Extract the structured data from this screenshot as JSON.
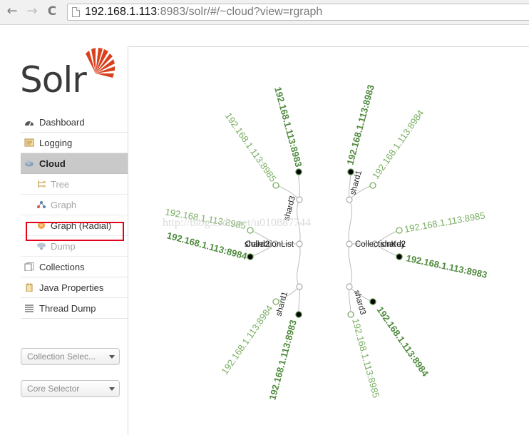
{
  "browser": {
    "back_icon": "←",
    "forward_icon": "→",
    "reload_icon": "C",
    "url_host": "192.168.1.113",
    "url_rest": ":8983/solr/#/~cloud?view=rgraph"
  },
  "logo": {
    "text": "Solr"
  },
  "sidebar": {
    "items": [
      {
        "label": "Dashboard",
        "icon": "dashboard-icon"
      },
      {
        "label": "Logging",
        "icon": "logging-icon"
      },
      {
        "label": "Cloud",
        "icon": "cloud-icon",
        "active": true
      },
      {
        "label": "Tree",
        "icon": "tree-icon"
      },
      {
        "label": "Graph",
        "icon": "graph-icon"
      },
      {
        "label": "Graph (Radial)",
        "icon": "radial-graph-icon",
        "selected": true
      },
      {
        "label": "Dump",
        "icon": "dump-icon"
      },
      {
        "label": "Collections",
        "icon": "collections-icon"
      },
      {
        "label": "Java Properties",
        "icon": "java-properties-icon"
      },
      {
        "label": "Thread Dump",
        "icon": "thread-dump-icon"
      }
    ],
    "collection_selector": "Collection Selec...",
    "core_selector": "Core Selector"
  },
  "graph": {
    "left_collection": "CollectionList",
    "left_collection_overlap": "shard2",
    "right_collection": "CollectionKey",
    "right_collection_overlap": "shard2",
    "shards": {
      "top_left": "shard3",
      "bottom_left": "shard1",
      "top_right": "shard1",
      "bottom_right": "shard3"
    },
    "replicas": {
      "tl_leader": "192.168.1.113:8983",
      "tl_follower": "192.168.1.113:8985",
      "ml_follower": "192.168.1.113:8985",
      "ml_leader": "192.168.1.113:8984",
      "bl_follower": "192.168.1.113:8984",
      "bl_leader": "192.168.1.113:8983",
      "tr_leader": "192.168.1.113:8983",
      "tr_follower": "192.168.1.113:8984",
      "mr_follower": "192.168.1.113:8985",
      "mr_leader": "192.168.1.113:8983",
      "br_leader": "192.168.1.113:8984",
      "br_follower": "192.168.1.113:8985"
    },
    "colors": {
      "leader": "#4f8a3e",
      "follower": "#7aae61",
      "link": "#bbbbbb"
    }
  },
  "watermark": "http://blog.csdn.net/u010887744"
}
